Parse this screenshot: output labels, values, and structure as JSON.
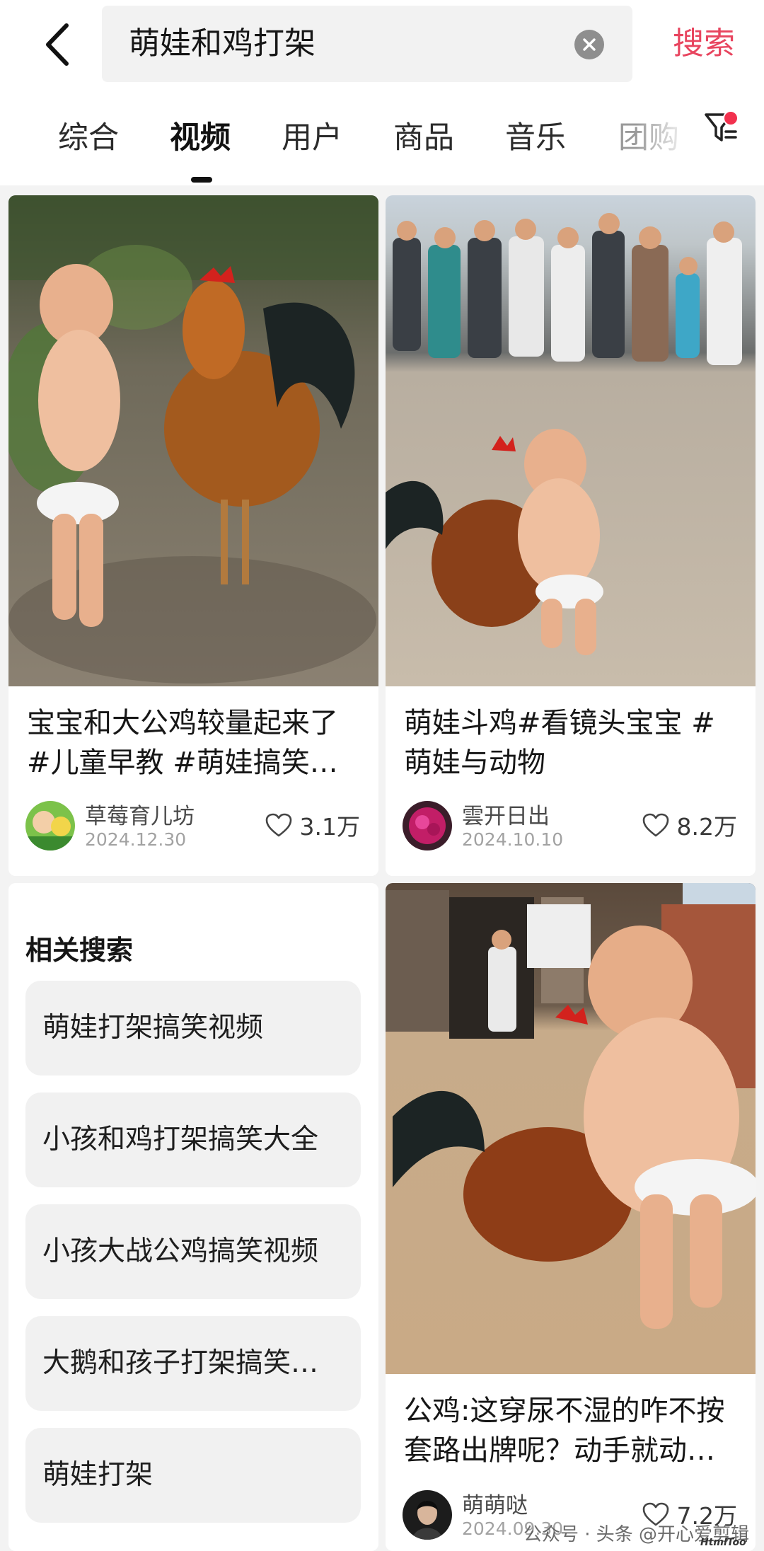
{
  "search": {
    "query": "萌娃和鸡打架",
    "submit_label": "搜索"
  },
  "icons": {
    "back": "chevron-left-icon",
    "clear": "clear-circle-icon",
    "filter": "filter-icon",
    "heart": "heart-outline-icon"
  },
  "colors": {
    "accent": "#e8455f",
    "filter_badge": "#f2314e",
    "feed_background": "#f3f3f3"
  },
  "tabs": [
    {
      "label": "综合",
      "active": false
    },
    {
      "label": "视频",
      "active": true
    },
    {
      "label": "用户",
      "active": false
    },
    {
      "label": "商品",
      "active": false
    },
    {
      "label": "音乐",
      "active": false
    },
    {
      "label": "团购",
      "active": false
    }
  ],
  "cards": [
    {
      "title": "宝宝和大公鸡较量起来了 #儿童早教 #萌娃搞笑…",
      "author": "草莓育儿坊",
      "date": "2024.12.30",
      "likes": "3.1万"
    },
    {
      "title": "萌娃斗鸡#看镜头宝宝 #萌娃与动物",
      "author": "雲开日出",
      "date": "2024.10.10",
      "likes": "8.2万"
    },
    {
      "title": "公鸡:这穿尿不湿的咋不按套路出牌呢？动手就动…",
      "author": "萌萌哒",
      "date": "2024.09.30",
      "likes": "7.2万"
    }
  ],
  "related": {
    "title": "相关搜索",
    "items": [
      "萌娃打架搞笑视频",
      "小孩和鸡打架搞笑大全",
      "小孩大战公鸡搞笑视频",
      "大鹅和孩子打架搞笑…",
      "萌娃打架"
    ]
  },
  "watermark": {
    "text": "公众号 · 头条 @开心爱剪辑",
    "corner": "HtmlToo"
  }
}
